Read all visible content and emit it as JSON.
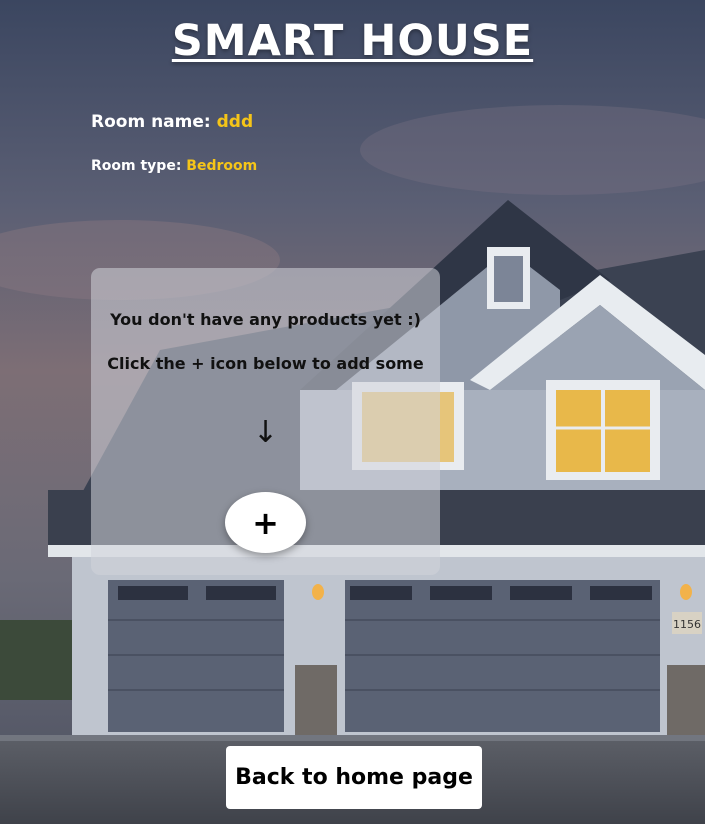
{
  "app": {
    "title": "SMART HOUSE"
  },
  "room": {
    "name_label": "Room name:",
    "name_value": "ddd",
    "type_label": "Room type:",
    "type_value": "Bedroom"
  },
  "products_panel": {
    "empty_message": "You don't have any products yet :)",
    "hint_message": "Click the + icon below to add some",
    "arrow_glyph": "↓",
    "add_button_label": "+"
  },
  "navigation": {
    "back_label": "Back to home page"
  },
  "colors": {
    "accent": "#f5c518",
    "title": "#ffffff",
    "panel_bg": "rgba(210,212,218,0.55)"
  },
  "background": {
    "house_number": "1156"
  }
}
